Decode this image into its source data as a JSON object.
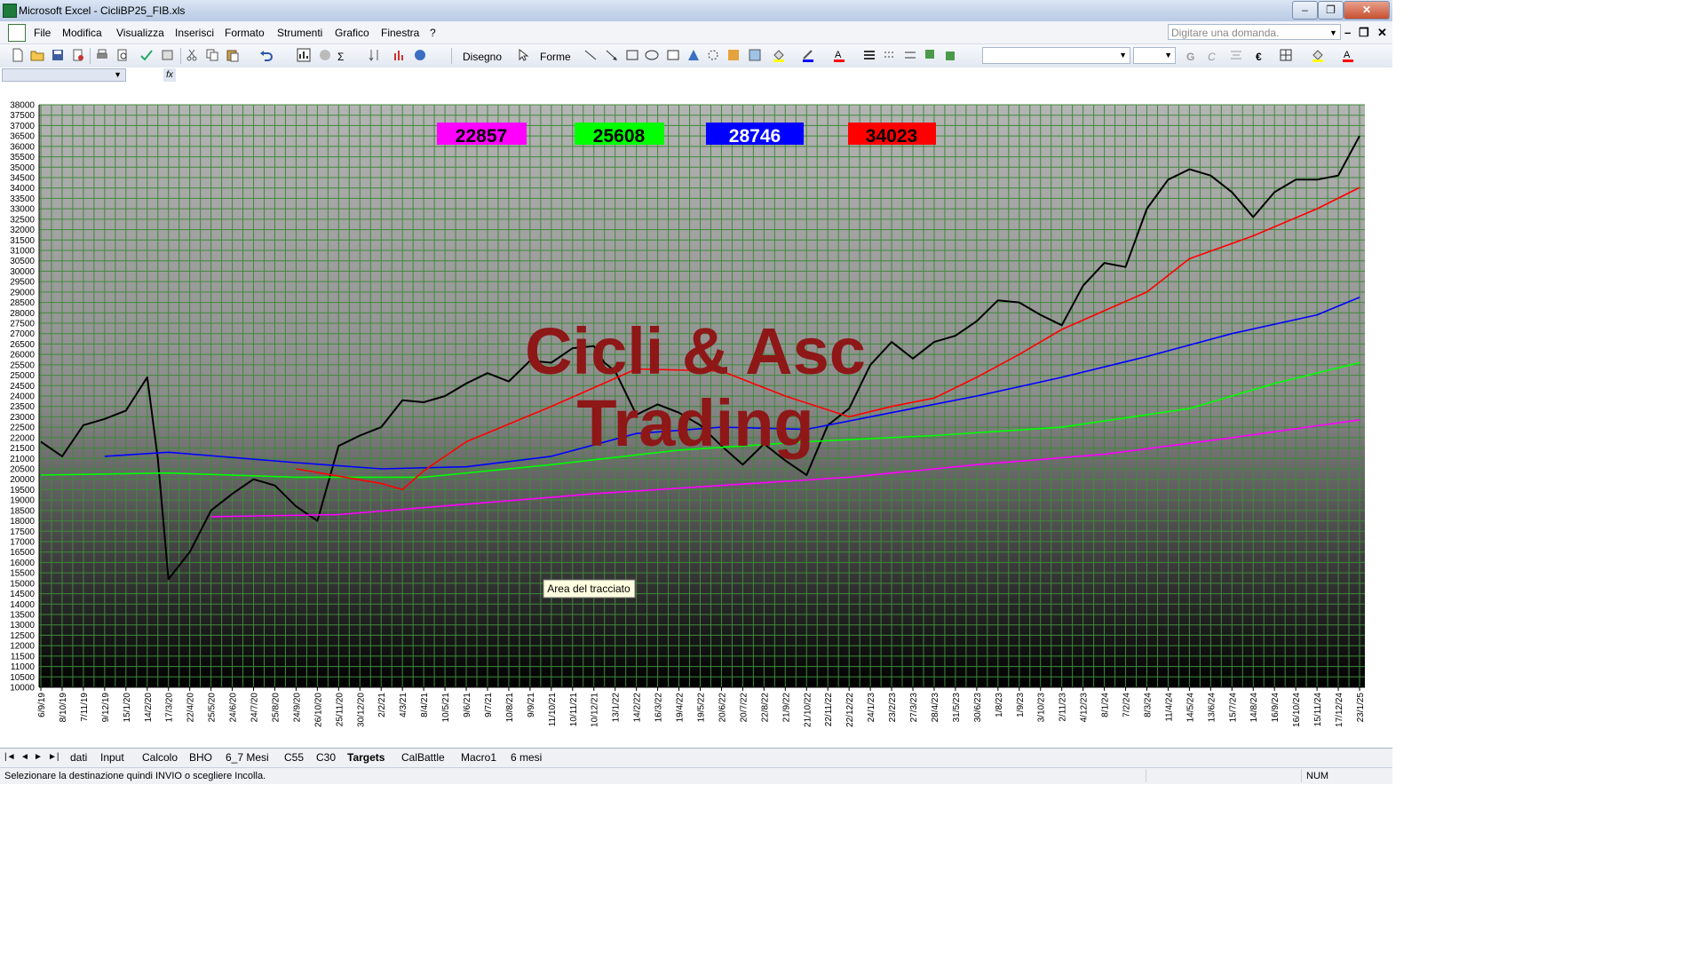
{
  "window": {
    "title": "Microsoft Excel - CicliBP25_FIB.xls",
    "minimize": "–",
    "maximize": "❐",
    "close": "✕"
  },
  "menu": {
    "items": [
      "File",
      "Modifica",
      "Visualizza",
      "Inserisci",
      "Formato",
      "Strumenti",
      "Grafico",
      "Finestra",
      "?"
    ],
    "ask_placeholder": "Digitare una domanda."
  },
  "toolbar": {
    "draw_label": "Disegno",
    "shapes_label": "Forme",
    "euro_label": "€"
  },
  "formula": {
    "name_value": "",
    "fx_label": "fx"
  },
  "tooltip": "Area del tracciato",
  "watermark": [
    "Cicli & Asc",
    "Trading"
  ],
  "level_boxes": [
    {
      "value": "22857",
      "color": "#ff00ff"
    },
    {
      "value": "25608",
      "color": "#00ff00"
    },
    {
      "value": "28746",
      "color": "#0000ff"
    },
    {
      "value": "34023",
      "color": "#ff0000"
    }
  ],
  "chart_data": {
    "type": "line",
    "ylim": [
      10000,
      38000
    ],
    "ytick_step": 500,
    "grid": true,
    "x_ticks": [
      "6/9/19",
      "8/10/19",
      "7/11/19",
      "9/12/19",
      "15/1/20",
      "14/2/20",
      "17/3/20",
      "22/4/20",
      "25/5/20",
      "24/6/20",
      "24/7/20",
      "25/8/20",
      "24/9/20",
      "26/10/20",
      "25/11/20",
      "30/12/20",
      "2/2/21",
      "4/3/21",
      "8/4/21",
      "10/5/21",
      "9/6/21",
      "9/7/21",
      "10/8/21",
      "9/9/21",
      "11/10/21",
      "10/11/21",
      "10/12/21",
      "13/1/22",
      "14/2/22",
      "16/3/22",
      "19/4/22",
      "19/5/22",
      "20/6/22",
      "20/7/22",
      "22/8/22",
      "21/9/22",
      "21/10/22",
      "22/11/22",
      "22/12/22",
      "24/1/23",
      "23/2/23",
      "27/3/23",
      "28/4/23",
      "31/5/23",
      "30/6/23",
      "1/8/23",
      "1/9/23",
      "3/10/23",
      "2/11/23",
      "4/12/23",
      "8/1/24",
      "7/2/24",
      "8/3/24",
      "11/4/24",
      "14/5/24",
      "13/6/24",
      "15/7/24",
      "14/8/24",
      "16/9/24",
      "16/10/24",
      "15/11/24",
      "17/12/24",
      "23/1/25"
    ],
    "series": [
      {
        "color": "#000000",
        "points": [
          [
            0,
            21800
          ],
          [
            1,
            21100
          ],
          [
            2,
            22600
          ],
          [
            3,
            22900
          ],
          [
            4,
            23300
          ],
          [
            5,
            24900
          ],
          [
            5.5,
            21000
          ],
          [
            6,
            15200
          ],
          [
            7,
            16500
          ],
          [
            8,
            18500
          ],
          [
            9,
            19300
          ],
          [
            10,
            20000
          ],
          [
            11,
            19700
          ],
          [
            12,
            18700
          ],
          [
            13,
            18000
          ],
          [
            14,
            21600
          ],
          [
            15,
            22100
          ],
          [
            16,
            22500
          ],
          [
            17,
            23800
          ],
          [
            18,
            23700
          ],
          [
            19,
            24000
          ],
          [
            20,
            24600
          ],
          [
            21,
            25100
          ],
          [
            22,
            24700
          ],
          [
            23,
            25700
          ],
          [
            24,
            25600
          ],
          [
            25,
            26300
          ],
          [
            26,
            26400
          ],
          [
            26.5,
            25600
          ],
          [
            27,
            25200
          ],
          [
            28,
            23100
          ],
          [
            29,
            23600
          ],
          [
            30,
            23200
          ],
          [
            31,
            22600
          ],
          [
            32,
            21600
          ],
          [
            33,
            20700
          ],
          [
            34,
            21700
          ],
          [
            35,
            20900
          ],
          [
            36,
            20200
          ],
          [
            37,
            22600
          ],
          [
            38,
            23400
          ],
          [
            39,
            25500
          ],
          [
            40,
            26600
          ],
          [
            41,
            25800
          ],
          [
            42,
            26600
          ],
          [
            43,
            26900
          ],
          [
            44,
            27600
          ],
          [
            45,
            28600
          ],
          [
            46,
            28500
          ],
          [
            47,
            27900
          ],
          [
            48,
            27400
          ],
          [
            49,
            29300
          ],
          [
            50,
            30400
          ],
          [
            51,
            30200
          ],
          [
            52,
            33000
          ],
          [
            53,
            34400
          ],
          [
            54,
            34900
          ],
          [
            55,
            34600
          ],
          [
            56,
            33800
          ],
          [
            57,
            32600
          ],
          [
            58,
            33800
          ],
          [
            59,
            34400
          ],
          [
            60,
            34400
          ],
          [
            61,
            34600
          ],
          [
            62,
            36500
          ]
        ]
      },
      {
        "color": "#ff00ff",
        "points": [
          [
            8,
            18200
          ],
          [
            14,
            18300
          ],
          [
            20,
            18800
          ],
          [
            26,
            19300
          ],
          [
            32,
            19700
          ],
          [
            38,
            20100
          ],
          [
            44,
            20700
          ],
          [
            50,
            21200
          ],
          [
            56,
            22000
          ],
          [
            62,
            22857
          ]
        ]
      },
      {
        "color": "#00ff00",
        "points": [
          [
            0,
            20200
          ],
          [
            6,
            20300
          ],
          [
            12,
            20100
          ],
          [
            18,
            20100
          ],
          [
            24,
            20700
          ],
          [
            30,
            21400
          ],
          [
            36,
            21800
          ],
          [
            42,
            22100
          ],
          [
            48,
            22500
          ],
          [
            54,
            23400
          ],
          [
            58,
            24600
          ],
          [
            62,
            25608
          ]
        ]
      },
      {
        "color": "#0000ff",
        "points": [
          [
            3,
            21100
          ],
          [
            6,
            21300
          ],
          [
            12,
            20800
          ],
          [
            16,
            20500
          ],
          [
            20,
            20600
          ],
          [
            24,
            21100
          ],
          [
            28,
            22200
          ],
          [
            32,
            22500
          ],
          [
            36,
            22400
          ],
          [
            40,
            23200
          ],
          [
            44,
            24000
          ],
          [
            48,
            24900
          ],
          [
            52,
            25900
          ],
          [
            56,
            27000
          ],
          [
            60,
            27900
          ],
          [
            62,
            28746
          ]
        ]
      },
      {
        "color": "#ff0000",
        "points": [
          [
            12,
            20500
          ],
          [
            16,
            19800
          ],
          [
            17,
            19500
          ],
          [
            18,
            20400
          ],
          [
            20,
            21800
          ],
          [
            24,
            23500
          ],
          [
            28,
            25300
          ],
          [
            32,
            25200
          ],
          [
            35,
            24000
          ],
          [
            38,
            23000
          ],
          [
            40,
            23500
          ],
          [
            42,
            23900
          ],
          [
            44,
            24900
          ],
          [
            46,
            26000
          ],
          [
            48,
            27200
          ],
          [
            50,
            28100
          ],
          [
            52,
            29000
          ],
          [
            54,
            30600
          ],
          [
            57,
            31700
          ],
          [
            60,
            33000
          ],
          [
            62,
            34023
          ]
        ]
      }
    ]
  },
  "sheet_tabs": {
    "nav": [
      "|◄",
      "◄",
      "►",
      "►|"
    ],
    "items": [
      "dati",
      "Input",
      "Calcolo",
      "BHO",
      "6_7 Mesi",
      "C55",
      "C30",
      "Targets",
      "CalBattle",
      "Macro1",
      "6 mesi"
    ],
    "active": "Targets"
  },
  "status": {
    "text": "Selezionare la destinazione quindi INVIO o scegliere Incolla.",
    "num": "NUM"
  }
}
